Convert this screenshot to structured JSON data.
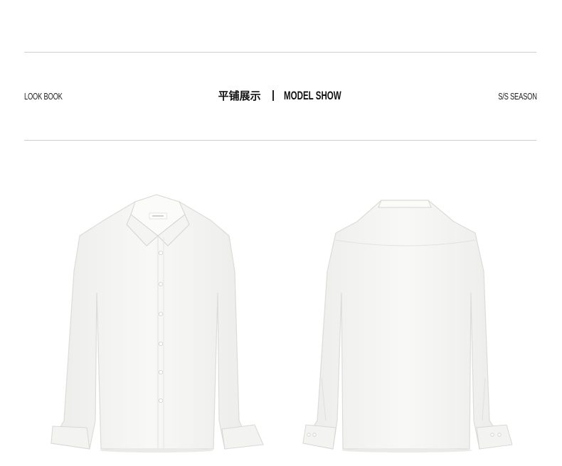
{
  "header": {
    "left_label": "LOOK BOOK",
    "title_zh": "平铺展示",
    "title_en": "MODEL SHOW",
    "right_label": "S/S SEASON"
  },
  "products": [
    {
      "view": "front",
      "icon": "white-shirt-front-image",
      "label_tag": "LOGO"
    },
    {
      "view": "back",
      "icon": "white-shirt-back-image"
    }
  ],
  "colors": {
    "shirt": "#f6f6f4",
    "shadow": "#e4e4e1",
    "rule": "#cfcfcf"
  }
}
